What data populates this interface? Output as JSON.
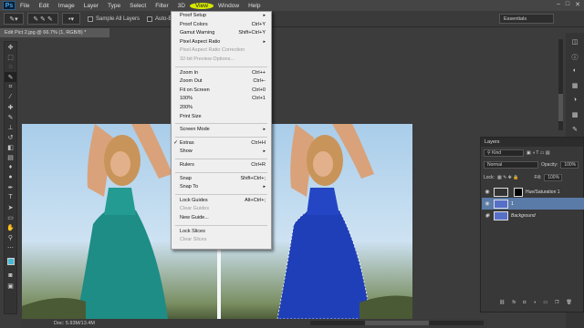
{
  "app": {
    "logo": "Ps"
  },
  "menubar": {
    "items": [
      "File",
      "Edit",
      "Image",
      "Layer",
      "Type",
      "Select",
      "Filter",
      "3D",
      "View",
      "Window",
      "Help"
    ],
    "window_controls": [
      "–",
      "□",
      "✕"
    ]
  },
  "options_bar": {
    "sample_all_layers": "Sample All Layers",
    "auto_enhance": "Auto-E",
    "workspace": "Essentials"
  },
  "document": {
    "tab_title": "Edit Pict 2.jpg @ 66.7% (1, RGB/8) *",
    "status": "Doc: 5.93M/13.4M"
  },
  "view_menu": [
    {
      "label": "Proof Setup",
      "shortcut": "",
      "submenu": true,
      "disabled": false
    },
    {
      "label": "Proof Colors",
      "shortcut": "Ctrl+Y",
      "submenu": false,
      "disabled": false
    },
    {
      "label": "Gamut Warning",
      "shortcut": "Shift+Ctrl+Y",
      "submenu": false,
      "disabled": false
    },
    {
      "label": "Pixel Aspect Ratio",
      "shortcut": "",
      "submenu": true,
      "disabled": false
    },
    {
      "label": "Pixel Aspect Ratio Correction",
      "shortcut": "",
      "submenu": false,
      "disabled": true
    },
    {
      "label": "32-bit Preview Options...",
      "shortcut": "",
      "submenu": false,
      "disabled": true
    },
    {
      "sep": true
    },
    {
      "label": "Zoom In",
      "shortcut": "Ctrl++",
      "submenu": false,
      "disabled": false
    },
    {
      "label": "Zoom Out",
      "shortcut": "Ctrl+-",
      "submenu": false,
      "disabled": false
    },
    {
      "label": "Fit on Screen",
      "shortcut": "Ctrl+0",
      "submenu": false,
      "disabled": false
    },
    {
      "label": "100%",
      "shortcut": "Ctrl+1",
      "submenu": false,
      "disabled": false
    },
    {
      "label": "200%",
      "shortcut": "",
      "submenu": false,
      "disabled": false
    },
    {
      "label": "Print Size",
      "shortcut": "",
      "submenu": false,
      "disabled": false
    },
    {
      "sep": true
    },
    {
      "label": "Screen Mode",
      "shortcut": "",
      "submenu": true,
      "disabled": false
    },
    {
      "sep": true
    },
    {
      "label": "Extras",
      "shortcut": "Ctrl+H",
      "submenu": false,
      "disabled": false,
      "checked": true
    },
    {
      "label": "Show",
      "shortcut": "",
      "submenu": true,
      "disabled": false
    },
    {
      "sep": true
    },
    {
      "label": "Rulers",
      "shortcut": "Ctrl+R",
      "submenu": false,
      "disabled": false
    },
    {
      "sep": true
    },
    {
      "label": "Snap",
      "shortcut": "Shift+Ctrl+;",
      "submenu": false,
      "disabled": false
    },
    {
      "label": "Snap To",
      "shortcut": "",
      "submenu": true,
      "disabled": false
    },
    {
      "sep": true
    },
    {
      "label": "Lock Guides",
      "shortcut": "Alt+Ctrl+;",
      "submenu": false,
      "disabled": false
    },
    {
      "label": "Clear Guides",
      "shortcut": "",
      "submenu": false,
      "disabled": true
    },
    {
      "label": "New Guide...",
      "shortcut": "",
      "submenu": false,
      "disabled": false
    },
    {
      "sep": true
    },
    {
      "label": "Lock Slices",
      "shortcut": "",
      "submenu": false,
      "disabled": false
    },
    {
      "label": "Clear Slices",
      "shortcut": "",
      "submenu": false,
      "disabled": true
    }
  ],
  "layers_panel": {
    "title": "Layers",
    "filter": "Kind",
    "blend_mode": "Normal",
    "opacity_label": "Opacity:",
    "opacity_value": "100%",
    "lock_label": "Lock:",
    "fill_label": "Fill:",
    "fill_value": "100%",
    "layers": [
      "Hue/Saturation 1",
      "1",
      "Background"
    ]
  }
}
